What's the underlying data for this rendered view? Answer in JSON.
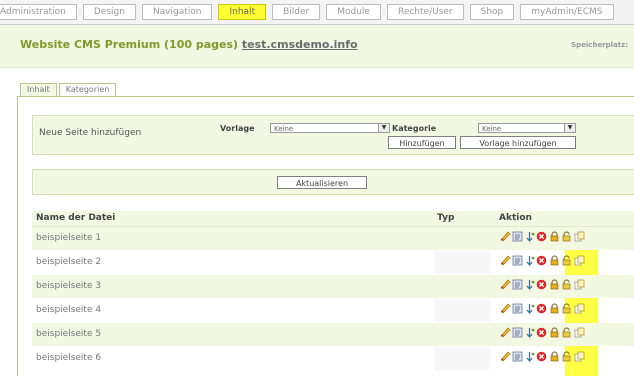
{
  "topnav": {
    "tabs": [
      {
        "label": "Administration",
        "active": false
      },
      {
        "label": "Design",
        "active": false
      },
      {
        "label": "Navigation",
        "active": false
      },
      {
        "label": "Inhalt",
        "active": true
      },
      {
        "label": "Bilder",
        "active": false
      },
      {
        "label": "Module",
        "active": false
      },
      {
        "label": "Rechte/User",
        "active": false
      },
      {
        "label": "Shop",
        "active": false
      },
      {
        "label": "myAdmin/ECMS",
        "active": false
      }
    ]
  },
  "header": {
    "title": "Website CMS Premium (100 pages)",
    "domain": "test.cmsdemo.info",
    "storage": "Speicherplatz:"
  },
  "content_tabs": [
    {
      "label": "Inhalt",
      "active": true
    },
    {
      "label": "Kategorien",
      "active": false
    }
  ],
  "new_page": {
    "label": "Neue Seite hinzufügen",
    "vorlage_label": "Vorlage",
    "vorlage_value": "Keine",
    "kategorie_label": "Kategorie",
    "kategorie_value": "Keine",
    "add_button": "Hinzufügen",
    "add_template_button": "Vorlage hinzufügen"
  },
  "refresh_button": "Aktualisieren",
  "table": {
    "col_name": "Name der Datei",
    "col_typ": "Typ",
    "col_aktion": "Aktion",
    "rows": [
      {
        "name": "beispielseite 1"
      },
      {
        "name": "beispielseite 2"
      },
      {
        "name": "beispielseite 3"
      },
      {
        "name": "beispielseite 4"
      },
      {
        "name": "beispielseite 5"
      },
      {
        "name": "beispielseite 6"
      }
    ]
  },
  "action_icons": [
    "edit-icon",
    "properties-icon",
    "move-icon",
    "delete-icon",
    "lock-icon",
    "unlock-icon",
    "copy-icon"
  ],
  "colors": {
    "accent_green": "#7d9a2c",
    "light_green_bg": "#f3f8e2",
    "highlight_yellow": "#ffff44"
  }
}
